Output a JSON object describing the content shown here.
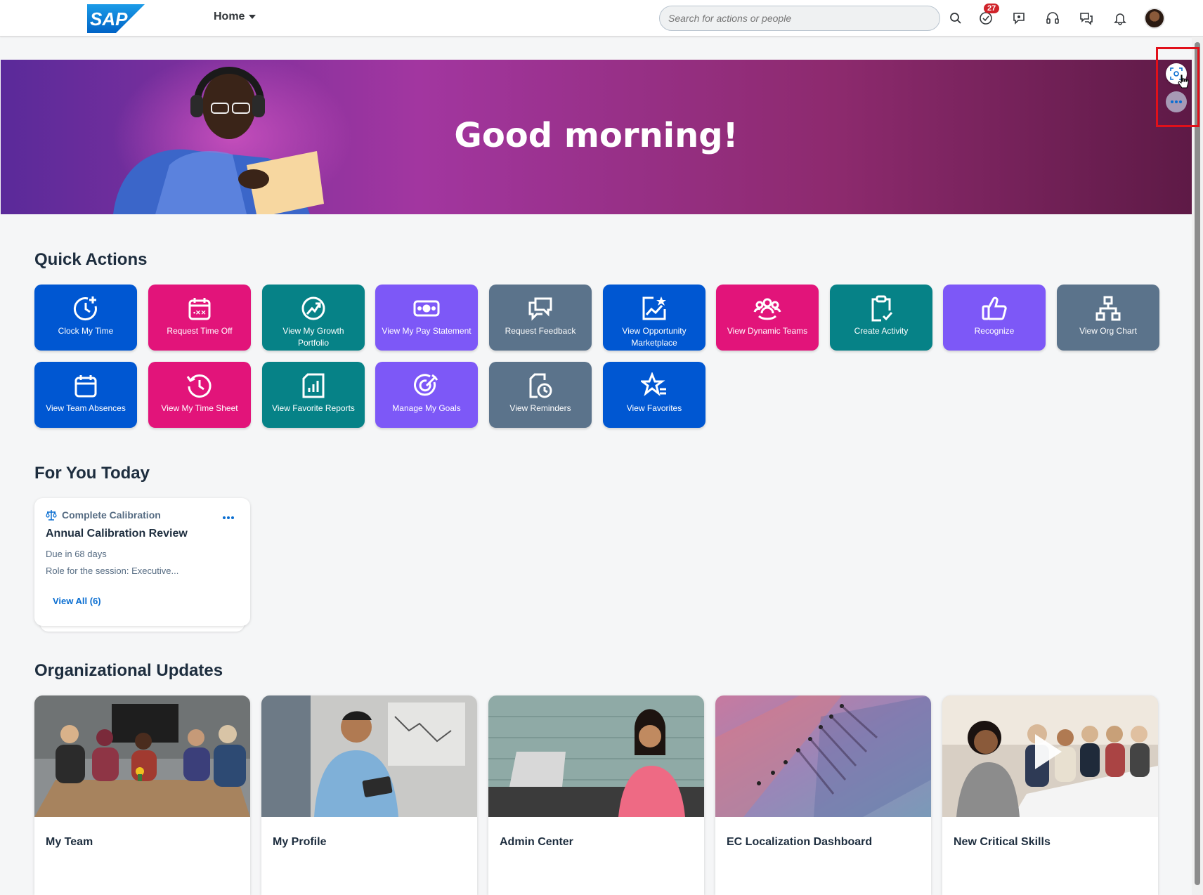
{
  "header": {
    "logo_text": "SAP",
    "home_label": "Home",
    "search_placeholder": "Search for actions or people",
    "todo_badge": "27",
    "icons": [
      "search-icon",
      "todo-icon",
      "chat-icon",
      "headset-icon",
      "feedback-icon",
      "bell-icon"
    ]
  },
  "banner": {
    "greeting": "Good morning!"
  },
  "quick_actions": {
    "title": "Quick Actions",
    "items": [
      {
        "label": "Clock My Time",
        "icon": "clock-add-icon",
        "color": "#0057d2"
      },
      {
        "label": "Request Time Off",
        "icon": "calendar-icon",
        "color": "#e2147a"
      },
      {
        "label": "View My Growth Portfolio",
        "icon": "growth-icon",
        "color": "#068287"
      },
      {
        "label": "View My Pay Statement",
        "icon": "money-icon",
        "color": "#7d58f7"
      },
      {
        "label": "Request Feedback",
        "icon": "feedback-bubbles-icon",
        "color": "#5b738b"
      },
      {
        "label": "View Opportunity Marketplace",
        "icon": "opportunity-icon",
        "color": "#0057d2"
      },
      {
        "label": "View Dynamic Teams",
        "icon": "team-icon",
        "color": "#e2147a"
      },
      {
        "label": "Create Activity",
        "icon": "clipboard-check-icon",
        "color": "#068287"
      },
      {
        "label": "Recognize",
        "icon": "thumbs-up-icon",
        "color": "#7d58f7"
      },
      {
        "label": "View Org Chart",
        "icon": "org-chart-icon",
        "color": "#5b738b"
      },
      {
        "label": "View Team Absences",
        "icon": "calendar-blank-icon",
        "color": "#0057d2"
      },
      {
        "label": "View My Time Sheet",
        "icon": "history-icon",
        "color": "#e2147a"
      },
      {
        "label": "View Favorite Reports",
        "icon": "report-icon",
        "color": "#068287"
      },
      {
        "label": "Manage My Goals",
        "icon": "target-icon",
        "color": "#7d58f7"
      },
      {
        "label": "View Reminders",
        "icon": "reminder-icon",
        "color": "#5b738b"
      },
      {
        "label": "View Favorites",
        "icon": "star-list-icon",
        "color": "#0057d2"
      }
    ]
  },
  "for_you_today": {
    "title": "For You Today",
    "card": {
      "category": "Complete Calibration",
      "title": "Annual Calibration Review",
      "due": "Due in 68 days",
      "role": "Role for the session: Executive...",
      "view_all": "View All (6)"
    }
  },
  "org_updates": {
    "title": "Organizational Updates",
    "cards": [
      {
        "title": "My Team"
      },
      {
        "title": "My Profile"
      },
      {
        "title": "Admin Center"
      },
      {
        "title": "EC Localization Dashboard"
      },
      {
        "title": "New Critical Skills"
      }
    ]
  },
  "colors": {
    "blue": "#0057d2",
    "pink": "#e2147a",
    "teal": "#068287",
    "purple": "#7d58f7",
    "gray": "#5b738b",
    "highlight": "#e1101a"
  }
}
